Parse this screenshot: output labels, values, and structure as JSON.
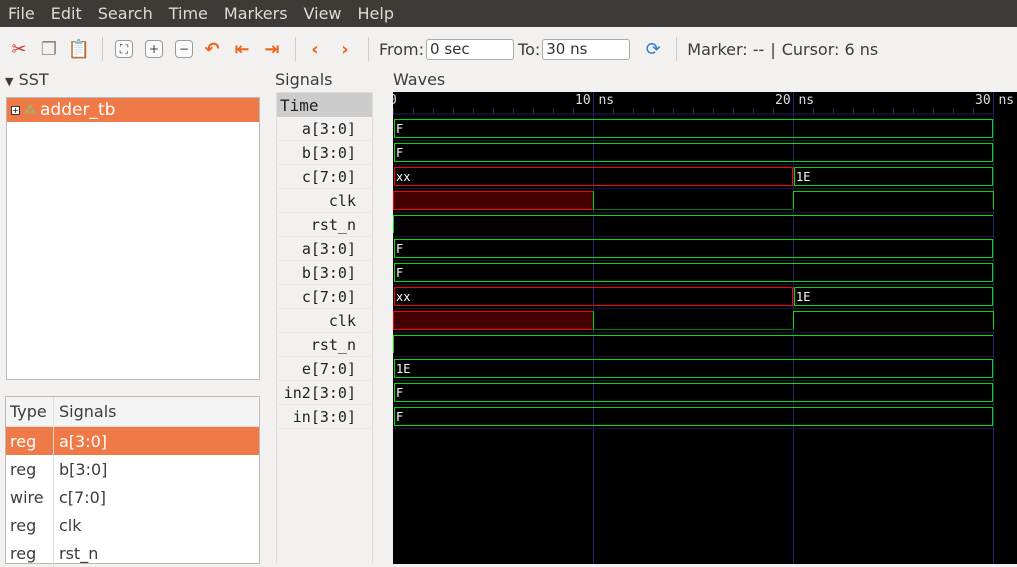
{
  "menu": [
    "File",
    "Edit",
    "Search",
    "Time",
    "Markers",
    "View",
    "Help"
  ],
  "toolbar": {
    "from_label": "From:",
    "from_value": "0 sec",
    "to_label": "To:",
    "to_value": "30 ns",
    "marker": "Marker: --",
    "sep": "|",
    "cursor": "Cursor: 6 ns"
  },
  "sst": {
    "title": "SST",
    "tree_item": "adder_tb"
  },
  "signal_table": {
    "headers": [
      "Type",
      "Signals"
    ],
    "rows": [
      [
        "reg",
        "a[3:0]"
      ],
      [
        "reg",
        "b[3:0]"
      ],
      [
        "wire",
        "c[7:0]"
      ],
      [
        "reg",
        "clk"
      ],
      [
        "reg",
        "rst_n"
      ]
    ]
  },
  "signals_title": "Signals",
  "time_label": "Time",
  "waves_title": "Waves",
  "time_axis": {
    "range_ns": [
      0,
      30
    ],
    "ticks": [
      "0",
      "10 ns",
      "20 ns",
      "30 ns"
    ],
    "cursor_ns": 6
  },
  "colors": {
    "bus": "#00e000",
    "x": "#ff0000",
    "xfill": "#440000",
    "grid": "#22226a",
    "bg": "#000000",
    "accent": "#f07a47"
  },
  "traces": [
    {
      "name": "a[3:0]",
      "type": "bus",
      "segs": [
        [
          0,
          30,
          "F"
        ]
      ]
    },
    {
      "name": "b[3:0]",
      "type": "bus",
      "segs": [
        [
          0,
          30,
          "F"
        ]
      ]
    },
    {
      "name": "c[7:0]",
      "type": "bus",
      "segs": [
        [
          0,
          20,
          "xx"
        ],
        [
          20,
          30,
          "1E"
        ]
      ]
    },
    {
      "name": "clk",
      "type": "bit",
      "segs": [
        [
          0,
          10,
          "x"
        ],
        [
          10,
          20,
          "0"
        ],
        [
          20,
          30,
          "1"
        ]
      ]
    },
    {
      "name": "rst_n",
      "type": "bit",
      "segs": [
        [
          0,
          30,
          "1"
        ]
      ]
    },
    {
      "name": "a[3:0]",
      "type": "bus",
      "segs": [
        [
          0,
          30,
          "F"
        ]
      ]
    },
    {
      "name": "b[3:0]",
      "type": "bus",
      "segs": [
        [
          0,
          30,
          "F"
        ]
      ]
    },
    {
      "name": "c[7:0]",
      "type": "bus",
      "segs": [
        [
          0,
          20,
          "xx"
        ],
        [
          20,
          30,
          "1E"
        ]
      ]
    },
    {
      "name": "clk",
      "type": "bit",
      "segs": [
        [
          0,
          10,
          "x"
        ],
        [
          10,
          20,
          "0"
        ],
        [
          20,
          30,
          "1"
        ]
      ]
    },
    {
      "name": "rst_n",
      "type": "bit",
      "segs": [
        [
          0,
          30,
          "1"
        ]
      ]
    },
    {
      "name": "e[7:0]",
      "type": "bus",
      "segs": [
        [
          0,
          30,
          "1E"
        ]
      ]
    },
    {
      "name": "in2[3:0]",
      "type": "bus",
      "segs": [
        [
          0,
          30,
          "F"
        ]
      ]
    },
    {
      "name": "in[3:0]",
      "type": "bus",
      "segs": [
        [
          0,
          30,
          "F"
        ]
      ]
    }
  ]
}
